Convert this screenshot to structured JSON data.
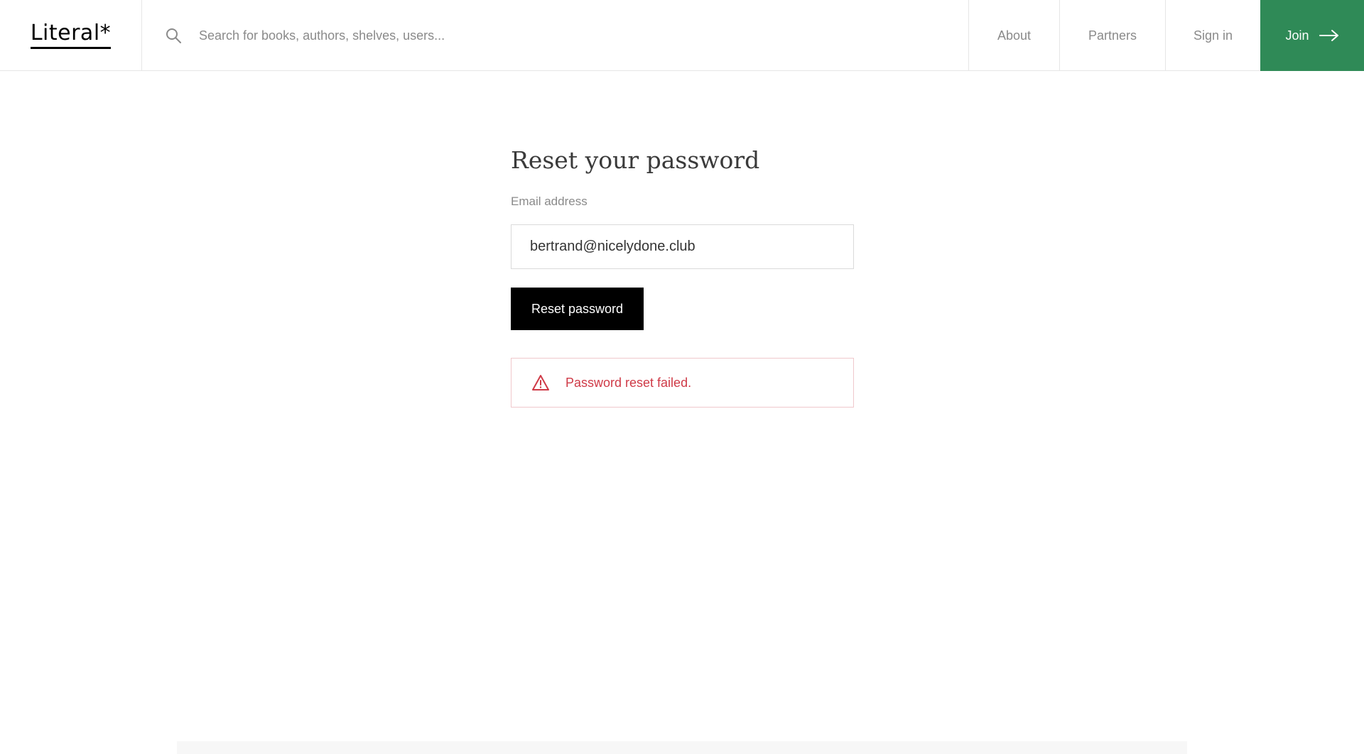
{
  "header": {
    "logo": "Literal*",
    "search_placeholder": "Search for books, authors, shelves, users...",
    "nav": {
      "about": "About",
      "partners": "Partners",
      "sign_in": "Sign in",
      "join": "Join"
    }
  },
  "main": {
    "title": "Reset your password",
    "email_label": "Email address",
    "email_value": "bertrand@nicelydone.club",
    "reset_button": "Reset password",
    "error_message": "Password reset failed."
  },
  "colors": {
    "join_bg": "#2f8a57",
    "error_text": "#cf3a47",
    "error_border": "#f0c8cc",
    "primary_button": "#000000"
  },
  "icons": [
    "search-icon",
    "arrow-right-icon",
    "warning-icon"
  ]
}
